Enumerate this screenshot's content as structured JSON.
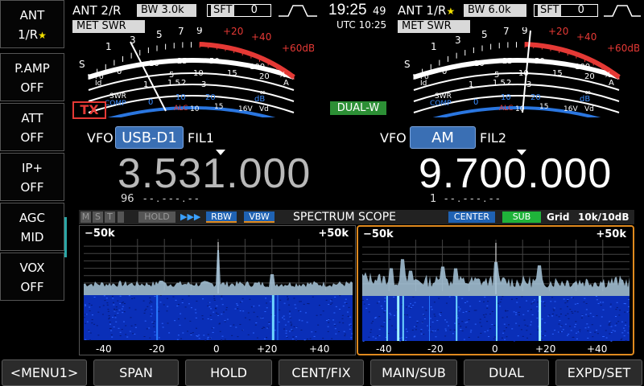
{
  "side_menu": [
    {
      "line1": "ANT",
      "line2": "1/R",
      "star": "★"
    },
    {
      "line1": "P.AMP",
      "line2": "OFF"
    },
    {
      "line1": "ATT",
      "line2": "OFF"
    },
    {
      "line1": "IP+",
      "line2": "OFF"
    },
    {
      "line1": "AGC",
      "line2": "MID"
    },
    {
      "line1": "VOX",
      "line2": "OFF"
    }
  ],
  "main": {
    "ant": "ANT 2/R",
    "bw_label": "BW",
    "bw_value": "3.0k",
    "sft_label": "SFT",
    "sft_value": "0",
    "met_label": "MET",
    "met_value": "SWR",
    "tx": "TX",
    "vfo_label": "VFO",
    "mode": "USB-D1",
    "filter": "FIL1",
    "frequency": "3.531.000",
    "sub_digits": "96",
    "sub_dashes": "- - . - - - . - -"
  },
  "sub": {
    "ant": "ANT 1/R",
    "star": "★",
    "bw_label": "BW",
    "bw_value": "6.0k",
    "sft_label": "SFT",
    "sft_value": "0",
    "met_label": "MET",
    "met_value": "SWR",
    "dual": "DUAL-W",
    "vfo_label": "VFO",
    "mode": "AM",
    "filter": "FIL2",
    "frequency": "9.700.000",
    "sub_digits": "1",
    "sub_dashes": "- - . - - - . - -"
  },
  "clock": {
    "time": "19:25",
    "seconds": "49",
    "utc": "UTC 10:25"
  },
  "meter_labels": {
    "s_scale": [
      "1",
      "3",
      "5",
      "7",
      "9",
      "+20",
      "+40",
      "+60dB"
    ],
    "po_scale": [
      "0",
      "10",
      "25",
      "50",
      "100",
      "%"
    ],
    "a_scale": [
      "5",
      "10",
      "15",
      "20",
      "A"
    ],
    "swr_scale": [
      "1",
      "1.5",
      "2",
      "3",
      "∞"
    ],
    "comp_scale": [
      "0",
      "10",
      "20",
      "dB"
    ],
    "vd_scale": [
      "10",
      "15",
      "16V"
    ],
    "left_words": [
      "S",
      "Po",
      "Id",
      "SWR",
      "COMP",
      "ALC",
      "Vd"
    ]
  },
  "scope": {
    "flags": [
      "M",
      "S",
      "T",
      "HOLD"
    ],
    "arrows": "▶▶▶",
    "rbw": "RBW",
    "vbw": "VBW",
    "title": "SPECTRUM SCOPE",
    "center": "CENTER",
    "sub": "SUB",
    "grid": "Grid",
    "span": "10k/10dB",
    "edge_left": "−50k",
    "edge_right": "+50k",
    "axis": [
      "-40",
      "-20",
      "0",
      "+20",
      "+40"
    ]
  },
  "bottom_menu": [
    "<MENU1>",
    "SPAN",
    "HOLD",
    "CENT/FIX",
    "MAIN/SUB",
    "DUAL",
    "EXPD/SET"
  ],
  "colors": {
    "accent_blue": "#3a6fb4",
    "alc_red": "#e53935",
    "dual_green": "#2c8f35",
    "scope_border": "#e08a1e",
    "sub_green": "#1fb33a"
  }
}
